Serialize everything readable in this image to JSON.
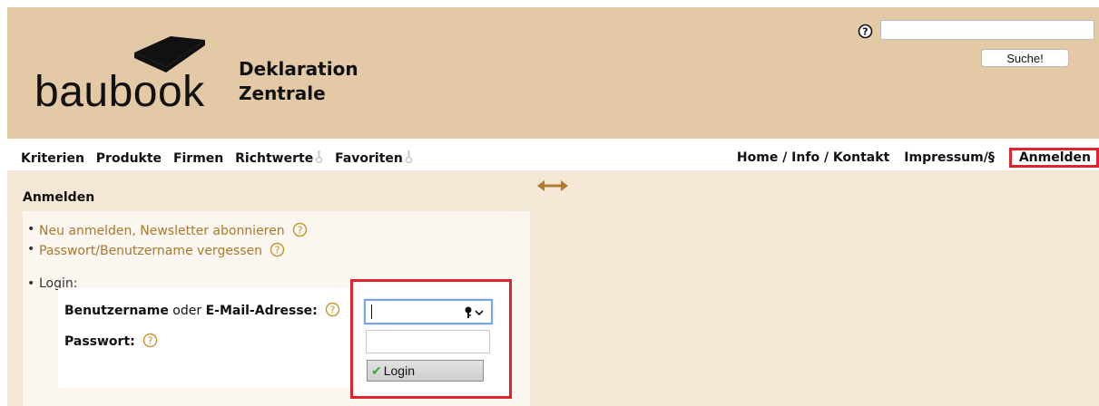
{
  "header": {
    "logo_word": "baubook",
    "logo_line1": "Deklaration",
    "logo_line2": "Zentrale",
    "search_value": "",
    "search_button": "Suche!"
  },
  "nav": {
    "left": [
      "Kriterien",
      "Produkte",
      "Firmen",
      "Richtwerte",
      "Favoriten"
    ],
    "right": [
      "Home / Info / Kontakt",
      "Impressum/§",
      "Anmelden"
    ]
  },
  "content": {
    "title": "Anmelden",
    "links": [
      "Neu anmelden, Newsletter abonnieren",
      "Passwort/Benutzername vergessen"
    ],
    "login_label": "Login:",
    "username_bold1": "Benutzername",
    "username_mid": " oder ",
    "username_bold2": "E-Mail-Adresse:",
    "password_label": "Passwort:",
    "login_button": "Login"
  },
  "colors": {
    "header_bg": "#e3c9a6",
    "content_bg": "#f5e7d6",
    "link": "#a9782d",
    "highlight": "#e0242e"
  }
}
